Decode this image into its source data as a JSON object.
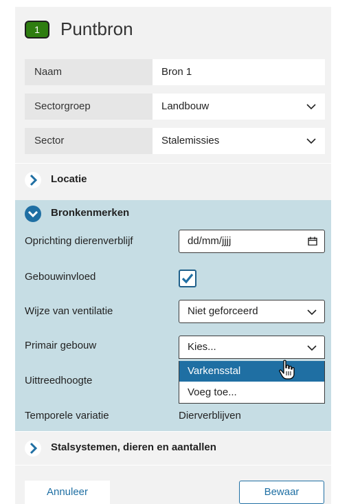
{
  "header": {
    "badge": "1",
    "title": "Puntbron"
  },
  "fields": [
    {
      "label": "Naam",
      "value": "Bron 1",
      "dropdown": false
    },
    {
      "label": "Sectorgroep",
      "value": "Landbouw",
      "dropdown": true
    },
    {
      "label": "Sector",
      "value": "Stalemissies",
      "dropdown": true
    }
  ],
  "sections": {
    "locatie": {
      "title": "Locatie",
      "expanded": false
    },
    "bronkenmerken": {
      "title": "Bronkenmerken",
      "expanded": true
    },
    "stalsystemen": {
      "title": "Stalsystemen, dieren en aantallen",
      "expanded": false
    }
  },
  "bronkenmerken": {
    "oprichting_label": "Oprichting dierenverblijf",
    "oprichting_placeholder": "dd/mm/jjjj",
    "gebouwinvloed_label": "Gebouwinvloed",
    "gebouwinvloed_checked": true,
    "ventilatie_label": "Wijze van ventilatie",
    "ventilatie_value": "Niet geforceerd",
    "primair_label": "Primair gebouw",
    "primair_value": "Kies...",
    "primair_options": [
      "Varkensstal",
      "Voeg toe..."
    ],
    "primair_selected": "Varkensstal",
    "uittreedhoogte_label": "Uittreedhoogte",
    "temporele_label": "Temporele variatie",
    "temporele_value": "Dierverblijven"
  },
  "footer": {
    "cancel_label": "Annuleer",
    "save_label": "Bewaar"
  },
  "colors": {
    "accent": "#1f6fa3",
    "badge": "#2e7d10",
    "expanded_bg": "#c6dde4",
    "panel_bg": "#f2f2f2"
  }
}
